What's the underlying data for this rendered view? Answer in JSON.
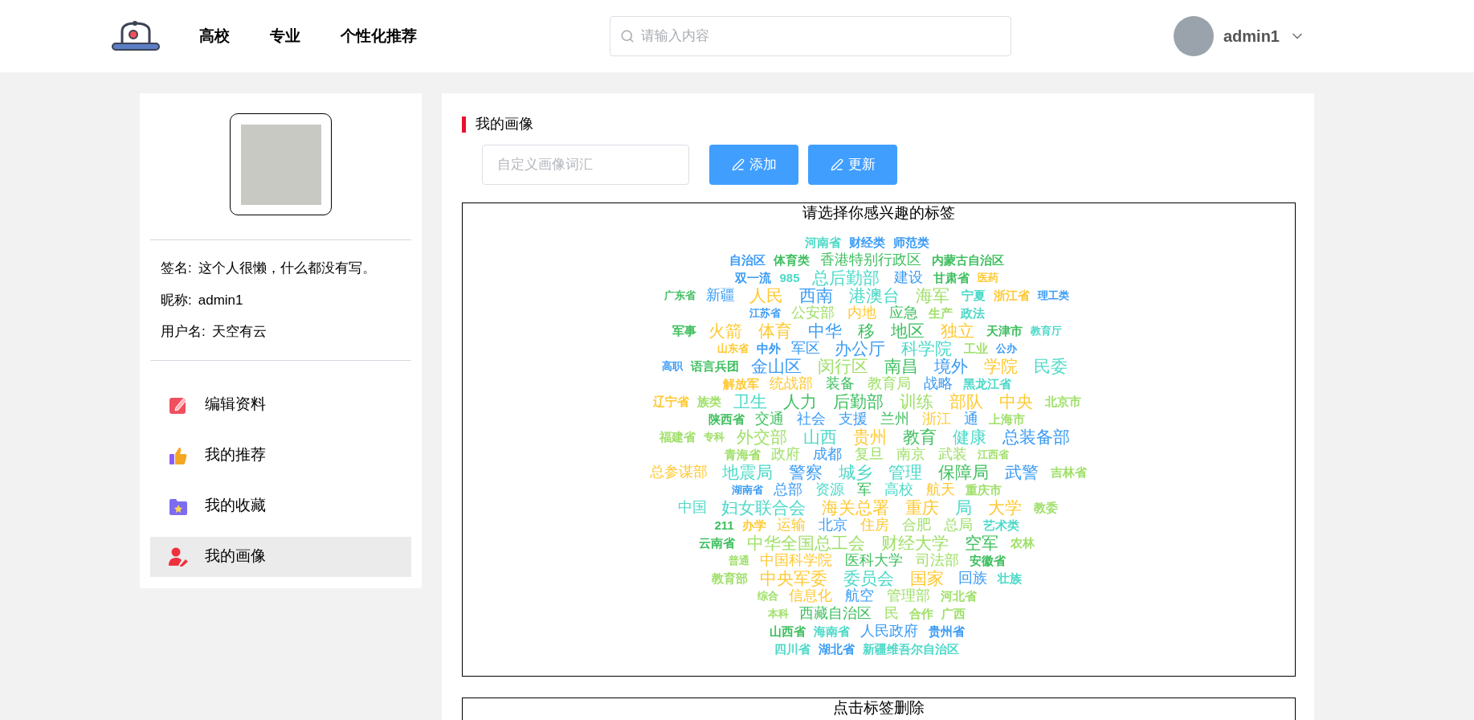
{
  "header": {
    "nav": [
      {
        "label": "高校"
      },
      {
        "label": "专业"
      },
      {
        "label": "个性化推荐"
      }
    ],
    "search": {
      "placeholder": "请输入内容"
    },
    "user": {
      "name": "admin1"
    }
  },
  "profile": {
    "info": [
      {
        "label": "签名:",
        "value": "这个人很懒，什么都没有写。"
      },
      {
        "label": "昵称:",
        "value": "admin1"
      },
      {
        "label": "用户名:",
        "value": "天空有云"
      }
    ],
    "menu": [
      {
        "label": "编辑资料",
        "kind": "edit",
        "selected": false
      },
      {
        "label": "我的推荐",
        "kind": "thumb",
        "selected": false
      },
      {
        "label": "我的收藏",
        "kind": "folder",
        "selected": false
      },
      {
        "label": "我的画像",
        "kind": "user",
        "selected": true
      }
    ]
  },
  "portrait": {
    "title": "我的画像",
    "input": {
      "placeholder": "自定义画像词汇"
    },
    "buttons": [
      {
        "label": "添加"
      },
      {
        "label": "更新"
      }
    ],
    "cloud": {
      "title": "请选择你感兴趣的标签",
      "rows": [
        [
          {
            "text": "河南省",
            "kind": "small",
            "color": "#4dd9c8"
          },
          {
            "text": "财经类",
            "kind": "small",
            "color": "#3a9bf5"
          },
          {
            "text": "师范类",
            "kind": "small",
            "color": "#3a9bf5"
          }
        ],
        [
          {
            "text": "自治区",
            "kind": "small",
            "color": "#3a9bf5"
          },
          {
            "text": "体育类",
            "kind": "small",
            "color": "#3fbf5f"
          },
          {
            "text": "香港特别行政区",
            "kind": "mid",
            "color": "#3fbf5f"
          },
          {
            "text": "内蒙古自治区",
            "kind": "small",
            "color": "#3fbf5f"
          }
        ],
        [
          {
            "text": "双一流",
            "kind": "small",
            "color": "#3a9bf5"
          },
          {
            "text": "985",
            "kind": "small",
            "color": "#4dd9c8"
          },
          {
            "text": "总后勤部",
            "kind": "big",
            "color": "#4dd9c8"
          },
          {
            "text": "建设",
            "kind": "mid",
            "color": "#3a9bf5"
          },
          {
            "text": "甘肃省",
            "kind": "small",
            "color": "#3fbf5f"
          },
          {
            "text": "医药",
            "kind": "tiny",
            "color": "#ffc933"
          }
        ],
        [
          {
            "text": "广东省",
            "kind": "tiny",
            "color": "#3fbf5f"
          },
          {
            "text": "新疆",
            "kind": "mid",
            "color": "#3a9bf5"
          },
          {
            "text": "人民",
            "kind": "big",
            "color": "#ffc933"
          },
          {
            "text": "西南",
            "kind": "big",
            "color": "#3a9bf5"
          },
          {
            "text": "港澳台",
            "kind": "big",
            "color": "#4dd9c8"
          },
          {
            "text": "海军",
            "kind": "big",
            "color": "#a0e06a"
          },
          {
            "text": "宁夏",
            "kind": "small",
            "color": "#4dd9c8"
          },
          {
            "text": "浙江省",
            "kind": "small",
            "color": "#ffc933"
          },
          {
            "text": "理工类",
            "kind": "tiny",
            "color": "#3a9bf5"
          }
        ],
        [
          {
            "text": "江苏省",
            "kind": "tiny",
            "color": "#3a9bf5"
          },
          {
            "text": "公安部",
            "kind": "mid",
            "color": "#a0e06a"
          },
          {
            "text": "内地",
            "kind": "mid",
            "color": "#ffc933"
          },
          {
            "text": "应急",
            "kind": "mid",
            "color": "#3fbf5f"
          },
          {
            "text": "生产",
            "kind": "small",
            "color": "#a0e06a"
          },
          {
            "text": "政法",
            "kind": "small",
            "color": "#4dd9c8"
          }
        ],
        [
          {
            "text": "军事",
            "kind": "small",
            "color": "#3fbf5f"
          },
          {
            "text": "火箭",
            "kind": "big",
            "color": "#ffc933"
          },
          {
            "text": "体育",
            "kind": "big",
            "color": "#ffc933"
          },
          {
            "text": "中华",
            "kind": "big",
            "color": "#3a9bf5"
          },
          {
            "text": "移",
            "kind": "big",
            "color": "#3fbf5f"
          },
          {
            "text": "地区",
            "kind": "big",
            "color": "#3fbf5f"
          },
          {
            "text": "独立",
            "kind": "big",
            "color": "#ffc933"
          },
          {
            "text": "天津市",
            "kind": "small",
            "color": "#3fbf5f"
          },
          {
            "text": "教育厅",
            "kind": "tiny",
            "color": "#4dd9c8"
          }
        ],
        [
          {
            "text": "山东省",
            "kind": "tiny",
            "color": "#ffc933"
          },
          {
            "text": "中外",
            "kind": "small",
            "color": "#3a9bf5"
          },
          {
            "text": "军区",
            "kind": "mid",
            "color": "#3a9bf5"
          },
          {
            "text": "办公厅",
            "kind": "big",
            "color": "#3a9bf5"
          },
          {
            "text": "科学院",
            "kind": "big",
            "color": "#4dd9c8"
          },
          {
            "text": "工业",
            "kind": "small",
            "color": "#a0e06a"
          },
          {
            "text": "公办",
            "kind": "tiny",
            "color": "#3a9bf5"
          }
        ],
        [
          {
            "text": "高职",
            "kind": "tiny",
            "color": "#3a9bf5"
          },
          {
            "text": "语言兵团",
            "kind": "small",
            "color": "#3fbf5f"
          },
          {
            "text": "金山区",
            "kind": "big",
            "color": "#3a9bf5"
          },
          {
            "text": "闵行区",
            "kind": "big",
            "color": "#a0e06a"
          },
          {
            "text": "南昌",
            "kind": "big",
            "color": "#3fbf5f"
          },
          {
            "text": "境外",
            "kind": "big",
            "color": "#3a9bf5"
          },
          {
            "text": "学院",
            "kind": "big",
            "color": "#ffc933"
          },
          {
            "text": "民委",
            "kind": "big",
            "color": "#4dd9c8"
          }
        ],
        [
          {
            "text": "解放军",
            "kind": "small",
            "color": "#ffc933"
          },
          {
            "text": "统战部",
            "kind": "mid",
            "color": "#ffc933"
          },
          {
            "text": "装备",
            "kind": "mid",
            "color": "#3fbf5f"
          },
          {
            "text": "教育局",
            "kind": "mid",
            "color": "#a0e06a"
          },
          {
            "text": "战略",
            "kind": "mid",
            "color": "#3a9bf5"
          },
          {
            "text": "黑龙江省",
            "kind": "small",
            "color": "#4dd9c8"
          }
        ],
        [
          {
            "text": "辽宁省",
            "kind": "small",
            "color": "#ffc933"
          },
          {
            "text": "族类",
            "kind": "small",
            "color": "#a0e06a"
          },
          {
            "text": "卫生",
            "kind": "big",
            "color": "#4dd9c8"
          },
          {
            "text": "人力",
            "kind": "big",
            "color": "#3fbf5f"
          },
          {
            "text": "后勤部",
            "kind": "big",
            "color": "#3fbf5f"
          },
          {
            "text": "训练",
            "kind": "big",
            "color": "#a0e06a"
          },
          {
            "text": "部队",
            "kind": "big",
            "color": "#ffc933"
          },
          {
            "text": "中央",
            "kind": "big",
            "color": "#ffc933"
          },
          {
            "text": "北京市",
            "kind": "small",
            "color": "#a0e06a"
          }
        ],
        [
          {
            "text": "陕西省",
            "kind": "small",
            "color": "#3fbf5f"
          },
          {
            "text": "交通",
            "kind": "mid",
            "color": "#3fbf5f"
          },
          {
            "text": "社会",
            "kind": "mid",
            "color": "#3a9bf5"
          },
          {
            "text": "支援",
            "kind": "mid",
            "color": "#3a9bf5"
          },
          {
            "text": "兰州",
            "kind": "mid",
            "color": "#3fbf5f"
          },
          {
            "text": "浙江",
            "kind": "mid",
            "color": "#ffc933"
          },
          {
            "text": "通",
            "kind": "mid",
            "color": "#3a9bf5"
          },
          {
            "text": "上海市",
            "kind": "small",
            "color": "#a0e06a"
          }
        ],
        [
          {
            "text": "福建省",
            "kind": "small",
            "color": "#a0e06a"
          },
          {
            "text": "专科",
            "kind": "tiny",
            "color": "#a0e06a"
          },
          {
            "text": "外交部",
            "kind": "big",
            "color": "#a0e06a"
          },
          {
            "text": "山西",
            "kind": "big",
            "color": "#4dd9c8"
          },
          {
            "text": "贵州",
            "kind": "big",
            "color": "#ffc933"
          },
          {
            "text": "教育",
            "kind": "big",
            "color": "#3fbf5f"
          },
          {
            "text": "健康",
            "kind": "big",
            "color": "#4dd9c8"
          },
          {
            "text": "总装备部",
            "kind": "big",
            "color": "#3a9bf5"
          }
        ],
        [
          {
            "text": "青海省",
            "kind": "small",
            "color": "#a0e06a"
          },
          {
            "text": "政府",
            "kind": "mid",
            "color": "#a0e06a"
          },
          {
            "text": "成都",
            "kind": "mid",
            "color": "#3a9bf5"
          },
          {
            "text": "复旦",
            "kind": "mid",
            "color": "#a0e06a"
          },
          {
            "text": "南京",
            "kind": "mid",
            "color": "#a0e06a"
          },
          {
            "text": "武装",
            "kind": "mid",
            "color": "#a0e06a"
          },
          {
            "text": "江西省",
            "kind": "tiny",
            "color": "#a0e06a"
          }
        ],
        [
          {
            "text": "总参谋部",
            "kind": "mid",
            "color": "#ffc933"
          },
          {
            "text": "地震局",
            "kind": "big",
            "color": "#4dd9c8"
          },
          {
            "text": "警察",
            "kind": "big",
            "color": "#3a9bf5"
          },
          {
            "text": "城乡",
            "kind": "big",
            "color": "#4dd9c8"
          },
          {
            "text": "管理",
            "kind": "big",
            "color": "#4dd9c8"
          },
          {
            "text": "保障局",
            "kind": "big",
            "color": "#3fbf5f"
          },
          {
            "text": "武警",
            "kind": "big",
            "color": "#3a9bf5"
          },
          {
            "text": "吉林省",
            "kind": "small",
            "color": "#a0e06a"
          }
        ],
        [
          {
            "text": "湖南省",
            "kind": "tiny",
            "color": "#3a9bf5"
          },
          {
            "text": "总部",
            "kind": "mid",
            "color": "#3a9bf5"
          },
          {
            "text": "资源",
            "kind": "mid",
            "color": "#4dd9c8"
          },
          {
            "text": "军",
            "kind": "mid",
            "color": "#3fbf5f"
          },
          {
            "text": "高校",
            "kind": "mid",
            "color": "#4dd9c8"
          },
          {
            "text": "航天",
            "kind": "mid",
            "color": "#ffc933"
          },
          {
            "text": "重庆市",
            "kind": "small",
            "color": "#a0e06a"
          }
        ],
        [
          {
            "text": "中国",
            "kind": "mid",
            "color": "#4dd9c8"
          },
          {
            "text": "妇女联合会",
            "kind": "big",
            "color": "#4dd9c8"
          },
          {
            "text": "海关总署",
            "kind": "big",
            "color": "#ffc933"
          },
          {
            "text": "重庆",
            "kind": "big",
            "color": "#ffc933"
          },
          {
            "text": "局",
            "kind": "big",
            "color": "#4dd9c8"
          },
          {
            "text": "大学",
            "kind": "big",
            "color": "#ffc933"
          },
          {
            "text": "教委",
            "kind": "small",
            "color": "#a0e06a"
          }
        ],
        [
          {
            "text": "211",
            "kind": "small",
            "color": "#3fbf5f"
          },
          {
            "text": "办学",
            "kind": "small",
            "color": "#ffc933"
          },
          {
            "text": "运输",
            "kind": "mid",
            "color": "#ffc933"
          },
          {
            "text": "北京",
            "kind": "mid",
            "color": "#3a9bf5"
          },
          {
            "text": "住房",
            "kind": "mid",
            "color": "#ffc933"
          },
          {
            "text": "合肥",
            "kind": "mid",
            "color": "#a0e06a"
          },
          {
            "text": "总局",
            "kind": "mid",
            "color": "#a0e06a"
          },
          {
            "text": "艺术类",
            "kind": "small",
            "color": "#4dd9c8"
          }
        ],
        [
          {
            "text": "云南省",
            "kind": "small",
            "color": "#3fbf5f"
          },
          {
            "text": "中华全国总工会",
            "kind": "big",
            "color": "#a0e06a"
          },
          {
            "text": "财经大学",
            "kind": "big",
            "color": "#a0e06a"
          },
          {
            "text": "空军",
            "kind": "big",
            "color": "#3fbf5f"
          },
          {
            "text": "农林",
            "kind": "small",
            "color": "#a0e06a"
          }
        ],
        [
          {
            "text": "普通",
            "kind": "tiny",
            "color": "#a0e06a"
          },
          {
            "text": "中国科学院",
            "kind": "mid",
            "color": "#ffc933"
          },
          {
            "text": "医科大学",
            "kind": "mid",
            "color": "#3fbf5f"
          },
          {
            "text": "司法部",
            "kind": "mid",
            "color": "#a0e06a"
          },
          {
            "text": "安徽省",
            "kind": "small",
            "color": "#3fbf5f"
          }
        ],
        [
          {
            "text": "教育部",
            "kind": "small",
            "color": "#a0e06a"
          },
          {
            "text": "中央军委",
            "kind": "big",
            "color": "#ffc933"
          },
          {
            "text": "委员会",
            "kind": "big",
            "color": "#4dd9c8"
          },
          {
            "text": "国家",
            "kind": "big",
            "color": "#ffc933"
          },
          {
            "text": "回族",
            "kind": "mid",
            "color": "#3a9bf5"
          },
          {
            "text": "壮族",
            "kind": "small",
            "color": "#4dd9c8"
          }
        ],
        [
          {
            "text": "综合",
            "kind": "tiny",
            "color": "#a0e06a"
          },
          {
            "text": "信息化",
            "kind": "mid",
            "color": "#ffc933"
          },
          {
            "text": "航空",
            "kind": "mid",
            "color": "#3a9bf5"
          },
          {
            "text": "管理部",
            "kind": "mid",
            "color": "#a0e06a"
          },
          {
            "text": "河北省",
            "kind": "small",
            "color": "#a0e06a"
          }
        ],
        [
          {
            "text": "本科",
            "kind": "tiny",
            "color": "#a0e06a"
          },
          {
            "text": "西藏自治区",
            "kind": "mid",
            "color": "#3fbf5f"
          },
          {
            "text": "民",
            "kind": "mid",
            "color": "#a0e06a"
          },
          {
            "text": "合作",
            "kind": "small",
            "color": "#a0e06a"
          },
          {
            "text": "广西",
            "kind": "small",
            "color": "#a0e06a"
          }
        ],
        [
          {
            "text": "山西省",
            "kind": "small",
            "color": "#3fbf5f"
          },
          {
            "text": "海南省",
            "kind": "small",
            "color": "#4dd9c8"
          },
          {
            "text": "人民政府",
            "kind": "mid",
            "color": "#3a9bf5"
          },
          {
            "text": "贵州省",
            "kind": "small",
            "color": "#3a9bf5"
          }
        ],
        [
          {
            "text": "四川省",
            "kind": "small",
            "color": "#4dd9c8"
          },
          {
            "text": "湖北省",
            "kind": "small",
            "color": "#3a9bf5"
          },
          {
            "text": "新疆维吾尔自治区",
            "kind": "small",
            "color": "#4dd9c8"
          }
        ]
      ]
    },
    "delete_box": {
      "title": "点击标签删除"
    }
  }
}
